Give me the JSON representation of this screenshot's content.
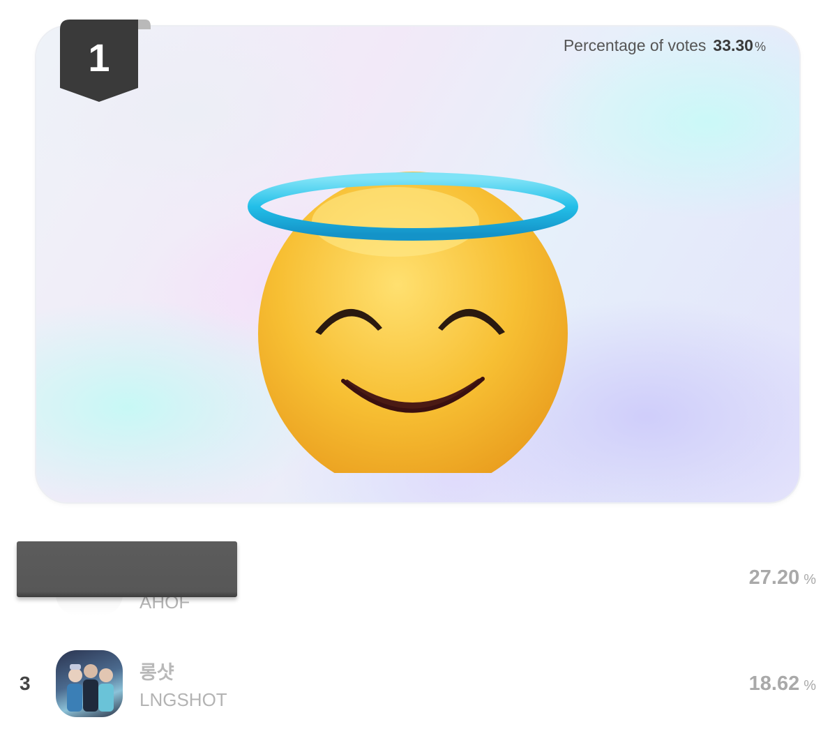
{
  "winner": {
    "rank": "1",
    "vote_label": "Percentage of votes",
    "vote_value": "33.30",
    "vote_unit": "%",
    "image": "smiling-face-with-halo-emoji"
  },
  "rankings": [
    {
      "rank": "",
      "name_ko": "",
      "name_en": "AHOF",
      "percentage": "27.20",
      "unit": "%",
      "redacted": true
    },
    {
      "rank": "3",
      "name_ko": "롱샷",
      "name_en": "LNGSHOT",
      "percentage": "18.62",
      "unit": "%"
    }
  ],
  "colors": {
    "badge": "#3a3a3a",
    "halo": "#28c6ec",
    "emoji_face": "#f6b92c",
    "muted_text": "#a9a9a9"
  }
}
